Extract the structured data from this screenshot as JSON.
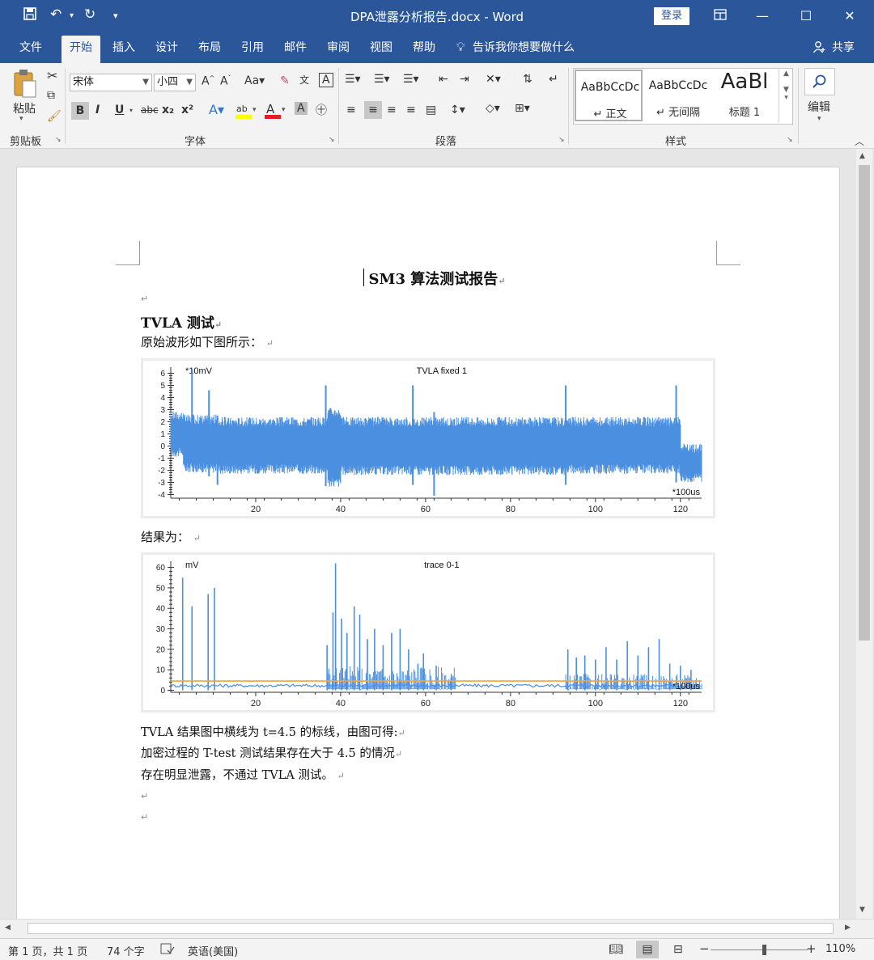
{
  "titlebar": {
    "doc_title": "DPA泄露分析报告.docx  -  Word",
    "login": "登录",
    "save_icon": "save-icon",
    "undo_icon": "undo-icon",
    "redo_icon": "redo-icon"
  },
  "tabs": [
    "文件",
    "开始",
    "插入",
    "设计",
    "布局",
    "引用",
    "邮件",
    "审阅",
    "视图",
    "帮助"
  ],
  "active_tab": "开始",
  "tellme": "告诉我你想要做什么",
  "share": "共享",
  "ribbon": {
    "paste": "粘贴",
    "clipboard": "剪贴板",
    "font_name": "宋体",
    "font_size": "小四",
    "font_group": "字体",
    "paragraph_group": "段落",
    "styles_group": "样式",
    "edit": "编辑",
    "aa_label": "Aa",
    "bold": "B",
    "italic": "I",
    "underline": "U",
    "strike": "abc",
    "sub": "x₂",
    "sup": "x²",
    "styles": [
      {
        "sample": "AaBbCcDc",
        "name": "↵ 正文"
      },
      {
        "sample": "AaBbCcDc",
        "name": "↵ 无间隔"
      },
      {
        "sample": "AaBl",
        "name": "标题 1"
      }
    ]
  },
  "document": {
    "title": "SM3 算法测试报告",
    "heading": "TVLA 测试",
    "intro": "原始波形如下图所示：",
    "result_label": "结果为：",
    "conclusion": [
      "TVLA 结果图中横线为 t=4.5 的标线，由图可得:",
      "加密过程的 T-test 测试结果存在大于 4.5 的情况",
      "存在明显泄露，不通过 TVLA 测试。"
    ],
    "para_mark": "↵"
  },
  "chart_data": [
    {
      "type": "line",
      "title": "TVLA fixed 1",
      "ylabel": "*10mV",
      "xlabel": "*100us",
      "xlim": [
        0,
        125
      ],
      "ylim": [
        -4.3,
        6.5
      ],
      "xticks": [
        20,
        40,
        60,
        80,
        100,
        120
      ],
      "yticks": [
        -4,
        -3,
        -2,
        -1,
        0,
        1,
        2,
        3,
        4,
        5,
        6
      ],
      "series_color": "#4a8fe0",
      "segments": [
        {
          "x0": 0,
          "x1": 3,
          "lo": -0.5,
          "hi": 2.5
        },
        {
          "x0": 3,
          "x1": 11,
          "lo": -1.8,
          "hi": 2.2
        },
        {
          "x0": 11,
          "x1": 37,
          "lo": -1.9,
          "hi": 2.0
        },
        {
          "x0": 37,
          "x1": 40,
          "lo": -3.0,
          "hi": 2.8
        },
        {
          "x0": 40,
          "x1": 64,
          "lo": -2.0,
          "hi": 2.0
        },
        {
          "x0": 64,
          "x1": 93,
          "lo": -2.0,
          "hi": 2.0
        },
        {
          "x0": 93,
          "x1": 120,
          "lo": -1.9,
          "hi": 2.0
        },
        {
          "x0": 120,
          "x1": 125,
          "lo": -2.6,
          "hi": -0.2
        }
      ],
      "spikes": [
        {
          "x": 5,
          "lo": -1.0,
          "hi": 6.4
        },
        {
          "x": 9,
          "lo": -2.5,
          "hi": 4.6
        },
        {
          "x": 11,
          "lo": -3.2,
          "hi": 2.5
        },
        {
          "x": 36.5,
          "lo": -3.3,
          "hi": 5.0
        },
        {
          "x": 57,
          "lo": -3.2,
          "hi": 5.0
        },
        {
          "x": 62,
          "lo": -4.1,
          "hi": 2.8
        },
        {
          "x": 93,
          "lo": -3.2,
          "hi": 5.0
        },
        {
          "x": 119,
          "lo": -3.0,
          "hi": 5.0
        }
      ]
    },
    {
      "type": "line",
      "title": "trace 0-1",
      "ylabel": "mV",
      "xlabel": "*100us",
      "xlim": [
        0,
        125
      ],
      "ylim": [
        -1,
        63
      ],
      "xticks": [
        20,
        40,
        60,
        80,
        100,
        120
      ],
      "yticks": [
        0,
        10,
        20,
        30,
        40,
        50,
        60
      ],
      "series_color": "#4a8fe0",
      "threshold": {
        "y": 4.5,
        "color": "#f0a43c"
      },
      "baseline": 1.5,
      "spikes": [
        {
          "x": 2.8,
          "y": 55
        },
        {
          "x": 5,
          "y": 41
        },
        {
          "x": 8.8,
          "y": 47
        },
        {
          "x": 10.3,
          "y": 50
        },
        {
          "x": 36.8,
          "y": 22
        },
        {
          "x": 38.2,
          "y": 38
        },
        {
          "x": 38.8,
          "y": 62
        },
        {
          "x": 40.2,
          "y": 35
        },
        {
          "x": 41.5,
          "y": 28
        },
        {
          "x": 43.2,
          "y": 41
        },
        {
          "x": 44.5,
          "y": 37
        },
        {
          "x": 46.3,
          "y": 25
        },
        {
          "x": 48,
          "y": 30
        },
        {
          "x": 50,
          "y": 22
        },
        {
          "x": 52,
          "y": 28
        },
        {
          "x": 54,
          "y": 30
        },
        {
          "x": 56,
          "y": 20
        },
        {
          "x": 58.2,
          "y": 13
        },
        {
          "x": 59.5,
          "y": 18
        },
        {
          "x": 62.5,
          "y": 12
        },
        {
          "x": 66,
          "y": 6
        },
        {
          "x": 93.5,
          "y": 20
        },
        {
          "x": 95.5,
          "y": 16
        },
        {
          "x": 97.5,
          "y": 17
        },
        {
          "x": 100,
          "y": 15
        },
        {
          "x": 102.5,
          "y": 21
        },
        {
          "x": 105,
          "y": 15
        },
        {
          "x": 107.5,
          "y": 24
        },
        {
          "x": 110,
          "y": 17
        },
        {
          "x": 112.5,
          "y": 21
        },
        {
          "x": 115,
          "y": 25
        },
        {
          "x": 117.5,
          "y": 13
        },
        {
          "x": 120,
          "y": 12
        },
        {
          "x": 122.5,
          "y": 10
        }
      ],
      "busy": [
        {
          "x0": 37,
          "x1": 67,
          "hi": 12
        },
        {
          "x0": 93,
          "x1": 125,
          "hi": 8
        }
      ]
    }
  ],
  "status": {
    "page": "第 1 页，共 1 页",
    "words": "74 个字",
    "lang": "英语(美国)",
    "zoom": "110%",
    "zoom_fraction": 0.55
  }
}
